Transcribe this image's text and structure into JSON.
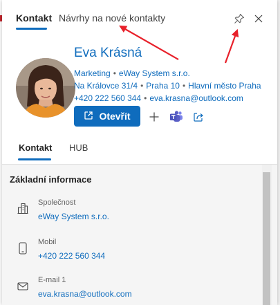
{
  "top_tabs": [
    "Kontakt",
    "Návrhy na nové kontakty"
  ],
  "contact": {
    "name": "Eva Krásná",
    "department": "Marketing",
    "company": "eWay System s.r.o.",
    "street": "Na Královce 31/4",
    "city": "Praha 10",
    "region": "Hlavní město Praha",
    "phone": "+420 222 560 344",
    "email": "eva.krasna@outlook.com"
  },
  "actions": {
    "open_label": "Otevřít",
    "icons": [
      "open-external-icon",
      "plus-icon",
      "teams-icon",
      "share-icon"
    ]
  },
  "content_tabs": [
    "Kontakt",
    "HUB"
  ],
  "section": {
    "title": "Základní informace",
    "fields": [
      {
        "label": "Společnost",
        "value": "eWay System s.r.o.",
        "icon": "building-icon"
      },
      {
        "label": "Mobil",
        "value": "+420 222 560 344",
        "icon": "mobile-phone-icon"
      },
      {
        "label": "E-mail 1",
        "value": "eva.krasna@outlook.com",
        "icon": "mail-icon"
      }
    ]
  },
  "colors": {
    "accent": "#0f6cbd",
    "annotation_arrow": "#e8202a",
    "teams": "#5b5fc7"
  }
}
